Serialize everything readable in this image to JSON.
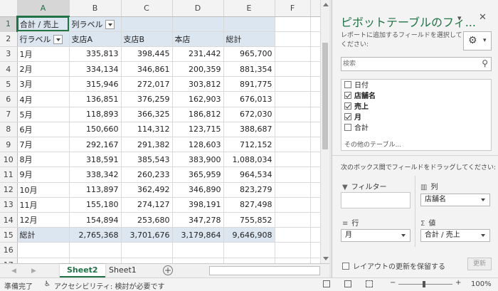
{
  "columns": [
    "A",
    "B",
    "C",
    "D",
    "E",
    "F"
  ],
  "row_numbers": [
    "1",
    "2",
    "3",
    "4",
    "5",
    "6",
    "7",
    "8",
    "9",
    "10",
    "11",
    "12",
    "13",
    "14",
    "15",
    "16",
    "17"
  ],
  "pivot": {
    "corner_label": "合計 / 売上",
    "col_label": "列ラベル",
    "row_label": "行ラベル",
    "headers": [
      "支店A",
      "支店B",
      "本店",
      "総計"
    ],
    "rows": [
      {
        "label": "1月",
        "values": [
          "335,813",
          "398,445",
          "231,442",
          "965,700"
        ]
      },
      {
        "label": "2月",
        "values": [
          "334,134",
          "346,861",
          "200,359",
          "881,354"
        ]
      },
      {
        "label": "3月",
        "values": [
          "315,946",
          "272,017",
          "303,812",
          "891,775"
        ]
      },
      {
        "label": "4月",
        "values": [
          "136,851",
          "376,259",
          "162,903",
          "676,013"
        ]
      },
      {
        "label": "5月",
        "values": [
          "118,893",
          "366,325",
          "186,812",
          "672,030"
        ]
      },
      {
        "label": "6月",
        "values": [
          "150,660",
          "114,312",
          "123,715",
          "388,687"
        ]
      },
      {
        "label": "7月",
        "values": [
          "292,167",
          "291,382",
          "128,603",
          "712,152"
        ]
      },
      {
        "label": "8月",
        "values": [
          "318,591",
          "385,543",
          "383,900",
          "1,088,034"
        ]
      },
      {
        "label": "9月",
        "values": [
          "338,342",
          "260,233",
          "365,959",
          "964,534"
        ]
      },
      {
        "label": "10月",
        "values": [
          "113,897",
          "362,492",
          "346,890",
          "823,279"
        ]
      },
      {
        "label": "11月",
        "values": [
          "155,180",
          "274,127",
          "398,191",
          "827,498"
        ]
      },
      {
        "label": "12月",
        "values": [
          "154,894",
          "253,680",
          "347,278",
          "755,852"
        ]
      }
    ],
    "total": {
      "label": "総計",
      "values": [
        "2,765,368",
        "3,701,676",
        "3,179,864",
        "9,646,908"
      ]
    }
  },
  "sheet_tabs": {
    "active": "Sheet2",
    "other": "Sheet1",
    "add": "+"
  },
  "status": {
    "ready": "準備完了",
    "accessibility": "アクセシビリティ: 検討が必要です",
    "zoom": "100%"
  },
  "pane": {
    "title": "ピボットテーブルのフィ...",
    "subtitle": "レポートに追加するフィールドを選択してください:",
    "search_placeholder": "検索",
    "fields": [
      {
        "label": "日付",
        "checked": false
      },
      {
        "label": "店舗名",
        "checked": true
      },
      {
        "label": "売上",
        "checked": true
      },
      {
        "label": "月",
        "checked": true
      },
      {
        "label": "合計",
        "checked": false
      }
    ],
    "more_tables": "その他のテーブル...",
    "drag_hint": "次のボックス間でフィールドをドラッグしてください:",
    "filter_label": "フィルター",
    "columns_label": "列",
    "columns_item": "店舗名",
    "rows_label": "行",
    "rows_item": "月",
    "values_label": "値",
    "values_item": "合計 / 売上",
    "defer_label": "レイアウトの更新を保留する",
    "update_label": "更新"
  },
  "colors": {
    "accent": "#217346",
    "pivot_fill": "#dce6f1"
  }
}
